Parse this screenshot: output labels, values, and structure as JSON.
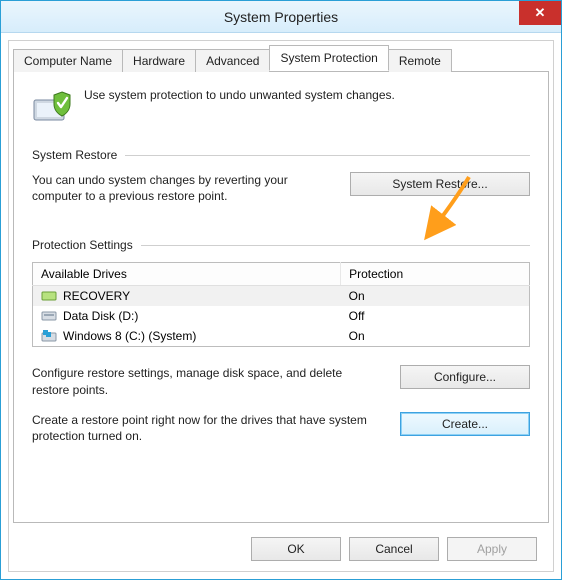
{
  "window": {
    "title": "System Properties"
  },
  "tabs": {
    "computer_name": "Computer Name",
    "hardware": "Hardware",
    "advanced": "Advanced",
    "system_protection": "System Protection",
    "remote": "Remote"
  },
  "intro": "Use system protection to undo unwanted system changes.",
  "restore": {
    "header": "System Restore",
    "text": "You can undo system changes by reverting your computer to a previous restore point.",
    "button": "System Restore..."
  },
  "protection": {
    "header": "Protection Settings",
    "col_drives": "Available Drives",
    "col_protection": "Protection",
    "rows": [
      {
        "name": "RECOVERY",
        "status": "On"
      },
      {
        "name": "Data Disk (D:)",
        "status": "Off"
      },
      {
        "name": "Windows 8 (C:) (System)",
        "status": "On"
      }
    ],
    "configure_text": "Configure restore settings, manage disk space, and delete restore points.",
    "configure_button": "Configure...",
    "create_text": "Create a restore point right now for the drives that have system protection turned on.",
    "create_button": "Create..."
  },
  "footer": {
    "ok": "OK",
    "cancel": "Cancel",
    "apply": "Apply"
  }
}
